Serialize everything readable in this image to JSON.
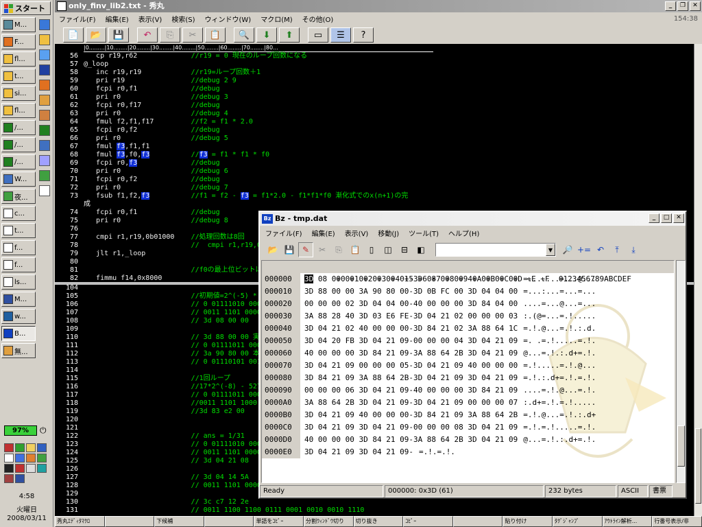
{
  "taskbar": {
    "start_label": "スタート",
    "tasks": [
      "M...",
      "F...",
      "fl...",
      "t...",
      "si...",
      "fl...",
      "/...",
      "/...",
      "/...",
      "W...",
      "夜...",
      "c...",
      "t...",
      "f...",
      "f...",
      "ls...",
      "M...",
      "w...",
      "B...",
      "無..."
    ],
    "tray": {
      "battery": "97%",
      "time": "4:58",
      "day": "火曜日",
      "date": "2008/03/11"
    }
  },
  "editor": {
    "title": "only_finv_lib2.txt - 秀丸",
    "menu": [
      "ファイル(F)",
      "編集(E)",
      "表示(V)",
      "検索(S)",
      "ウィンドウ(W)",
      "マクロ(M)",
      "その他(O)"
    ],
    "cursor_pos": "154:38",
    "ruler": "|0.........|10........|20........|30........|40........|50........|60........|70........|80...",
    "upper_lines": [
      {
        "n": "56",
        "code": "   cp r19,r62",
        "comment": "//r19 = 0 現在のループ回数になる"
      },
      {
        "n": "57",
        "code": "@_loop",
        "comment": ""
      },
      {
        "n": "58",
        "code": "   inc r19,r19",
        "comment": "//r19=ループ回数＋1"
      },
      {
        "n": "59",
        "code": "   pri r19 ",
        "comment": "//debug 2 9"
      },
      {
        "n": "60",
        "code": "   fcpi r0,f1 ",
        "comment": "//debug"
      },
      {
        "n": "61",
        "code": "   pri r0 ",
        "comment": "//debug 3"
      },
      {
        "n": "62",
        "code": "   fcpi r0,f17 ",
        "comment": "//debug"
      },
      {
        "n": "63",
        "code": "   pri r0 ",
        "comment": "//debug 4"
      },
      {
        "n": "64",
        "code": "   fmul f2,f1,f17",
        "comment": "//f2 = f1 * 2.0"
      },
      {
        "n": "65",
        "code": "   fcpi r0,f2 ",
        "comment": "//debug"
      },
      {
        "n": "66",
        "code": "   pri r0 ",
        "comment": "//debug 5"
      },
      {
        "n": "67",
        "code": "   fmul f3,f1,f1",
        "comment": ""
      },
      {
        "n": "68",
        "code": "   fmul f3,f0,f3",
        "comment": "//f3 = f1 * f1 * f0"
      },
      {
        "n": "69",
        "code": "   fcpi r0,f3 ",
        "comment": "//debug"
      },
      {
        "n": "70",
        "code": "   pri r0 ",
        "comment": "//debug 6"
      },
      {
        "n": "71",
        "code": "   fcpi r0,f2 ",
        "comment": "//debug"
      },
      {
        "n": "72",
        "code": "   pri r0 ",
        "comment": "//debug 7"
      },
      {
        "n": "73",
        "code": "   fsub f1,f2,f3",
        "comment": "//f1 = f2 - f3 = f1*2.0 - f1*f1*f0 漸化式でのx(n+1)の完"
      },
      {
        "n": "",
        "code": "成",
        "comment": ""
      },
      {
        "n": "74",
        "code": "   fcpi r0,f1 ",
        "comment": "//debug"
      },
      {
        "n": "75",
        "code": "   pri r0 ",
        "comment": "//debug 8"
      },
      {
        "n": "76",
        "code": "",
        "comment": ""
      },
      {
        "n": "77",
        "code": "   cmpi r1,r19,0b01000",
        "comment": "//処理回数は8回"
      },
      {
        "n": "78",
        "code": "",
        "comment": "//  cmpi r1,r19,0b00000    //処理回数は1回"
      },
      {
        "n": "79",
        "code": "   jlt r1,_loop",
        "comment": ""
      },
      {
        "n": "80",
        "code": "",
        "comment": ""
      },
      {
        "n": "81",
        "code": "   ",
        "comment": "//f0の最上位ビットは、invの前後で維持さ"
      },
      {
        "n": "82",
        "code": "   fimmu f14,0x8000",
        "comment": ""
      }
    ],
    "lower_lines": [
      {
        "n": "104",
        "code": "",
        "comment": ""
      },
      {
        "n": "105",
        "code": "",
        "comment": "//初期値=2^(-5) * (1 + 1/16)"
      },
      {
        "n": "106",
        "code": "",
        "comment": "// 0 01111010 00010000000000000000000"
      },
      {
        "n": "107",
        "code": "",
        "comment": "// 0011 1101 0000 1000 0000 0000 0000 0000"
      },
      {
        "n": "108",
        "code": "",
        "comment": "// 3d 08 00 00"
      },
      {
        "n": "109",
        "code": "",
        "comment": ""
      },
      {
        "n": "110",
        "code": "",
        "comment": "// 3d 88 00 00 実機が出した答え"
      },
      {
        "n": "111",
        "code": "",
        "comment": "// 0 01111011 00010000000000000000000"
      },
      {
        "n": "112",
        "code": "",
        "comment": "// 3a 90 80 00 本来の答え"
      },
      {
        "n": "113",
        "code": "",
        "comment": "// 0 01110101 00100001000000000000000"
      },
      {
        "n": "114",
        "code": "",
        "comment": ""
      },
      {
        "n": "115",
        "code": "",
        "comment": "//1回ループ"
      },
      {
        "n": "116",
        "code": "",
        "comment": "//17*2^(-8) - 527*2^(-18)"
      },
      {
        "n": "117",
        "code": "",
        "comment": "// 0 01111011 00001111110000000000000"
      },
      {
        "n": "118",
        "code": "",
        "comment": "//0011 1101 1000 0011 1110 0010 0000 0000"
      },
      {
        "n": "119",
        "code": "",
        "comment": "//3d 83 e2 00"
      },
      {
        "n": "120",
        "code": "",
        "comment": ""
      },
      {
        "n": "121",
        "code": "",
        "comment": ""
      },
      {
        "n": "122",
        "code": "",
        "comment": "// ans = 1/31"
      },
      {
        "n": "123",
        "code": "",
        "comment": "// 0 01111010 00001000010000100001000"
      },
      {
        "n": "124",
        "code": "",
        "comment": "// 0011 1101 0000 0100 0010 0001 0000 1000"
      },
      {
        "n": "125",
        "code": "",
        "comment": "// 3d 04 21 08"
      },
      {
        "n": "126",
        "code": "",
        "comment": ""
      },
      {
        "n": "127",
        "code": "",
        "comment": "// 3d 04 14 5A"
      },
      {
        "n": "128",
        "code": "",
        "comment": "// 0011 1101 0000 0100 0001 0100 0101 1010"
      },
      {
        "n": "129",
        "code": "",
        "comment": ""
      },
      {
        "n": "130",
        "code": "",
        "comment": "// 3c c7 12 2e"
      },
      {
        "n": "131",
        "code": "",
        "comment": "// 0011 1100 1100 0111 0001 0010 0010 1110"
      }
    ],
    "fkeys": [
      "秀丸ｴﾃﾞｨﾀﾏｸﾛ",
      "",
      "下候補",
      "",
      "単語をｺﾋﾟｰ",
      "分割ｳｨﾝﾄﾞｳ切り",
      "切り抜き",
      "ｺﾋﾟｰ",
      "",
      "貼り付け",
      "ﾀｸﾞｼﾞｬﾝﾌﾟ",
      "ｱｳﾄﾗｲﾝ解析...",
      "行番号表示/非"
    ]
  },
  "bz": {
    "title": "Bz - tmp.dat",
    "menu": [
      "ファイル(F)",
      "編集(E)",
      "表示(V)",
      "移動(J)",
      "ツール(T)",
      "ヘルプ(H)"
    ],
    "header": " +0 +1 +2 +3 +4 +5 +6 +7 +8 +9 +A +B +C +D +E +F  0123456789ABCDEF",
    "rows": [
      {
        "addr": "000000",
        "b1": "3D",
        "bytes": " 08 00 00 00 00 00 01-3D 08 00 00 40 00 00 00",
        "ascii": "=.......=...@..."
      },
      {
        "addr": "000010",
        "b1": "",
        "bytes": "3D 88 00 00 3A 90 80 00-3D 0B FC 00 3D 04 04 00",
        "ascii": "=...:...=...=..."
      },
      {
        "addr": "000020",
        "b1": "",
        "bytes": "00 00 00 02 3D 04 04 00-40 00 00 00 3D 84 04 00",
        "ascii": "....=...@...=..."
      },
      {
        "addr": "000030",
        "b1": "",
        "bytes": "3A 88 28 40 3D 03 E6 FE-3D 04 21 02 00 00 00 03",
        "ascii": ":.(@=...=.!....."
      },
      {
        "addr": "000040",
        "b1": "",
        "bytes": "3D 04 21 02 40 00 00 00-3D 84 21 02 3A 88 64 1C",
        "ascii": "=.!.@...=.!.:.d."
      },
      {
        "addr": "000050",
        "b1": "",
        "bytes": "3D 04 20 FB 3D 04 21 09-00 00 00 04 3D 04 21 09",
        "ascii": "=. .=.!.....=.!."
      },
      {
        "addr": "000060",
        "b1": "",
        "bytes": "40 00 00 00 3D 84 21 09-3A 88 64 2B 3D 04 21 09",
        "ascii": "@...=.!.:.d+=.!."
      },
      {
        "addr": "000070",
        "b1": "",
        "bytes": "3D 04 21 09 00 00 00 05-3D 04 21 09 40 00 00 00",
        "ascii": "=.!.....=.!.@..."
      },
      {
        "addr": "000080",
        "b1": "",
        "bytes": "3D 84 21 09 3A 88 64 2B-3D 04 21 09 3D 04 21 09",
        "ascii": "=.!.:.d+=.!.=.!."
      },
      {
        "addr": "000090",
        "b1": "",
        "bytes": "00 00 00 06 3D 04 21 09-40 00 00 00 3D 84 21 09",
        "ascii": "....=.!.@...=.!."
      },
      {
        "addr": "0000A0",
        "b1": "",
        "bytes": "3A 88 64 2B 3D 04 21 09-3D 04 21 09 00 00 00 07",
        "ascii": ":.d+=.!.=.!....."
      },
      {
        "addr": "0000B0",
        "b1": "",
        "bytes": "3D 04 21 09 40 00 00 00-3D 84 21 09 3A 88 64 2B",
        "ascii": "=.!.@...=.!.:.d+"
      },
      {
        "addr": "0000C0",
        "b1": "",
        "bytes": "3D 04 21 09 3D 04 21 09-00 00 00 08 3D 04 21 09",
        "ascii": "=.!.=.!.....=.!."
      },
      {
        "addr": "0000D0",
        "b1": "",
        "bytes": "40 00 00 00 3D 84 21 09-3A 88 64 2B 3D 04 21 09",
        "ascii": "@...=.!.:.d+=.!."
      },
      {
        "addr": "0000E0",
        "b1": "",
        "bytes": "3D 04 21 09 3D 04 21 09-",
        "ascii": "=.!.=.!."
      }
    ],
    "status": {
      "ready": "Ready",
      "position": "000000: 0x3D (61)",
      "size": "232 bytes",
      "encoding": "ASCII",
      "mode": "書票"
    }
  },
  "colors": {
    "code_bg": "#000000",
    "code_text": "#f0f0f0",
    "comment": "#00e000",
    "highlight": "#1030d8"
  }
}
